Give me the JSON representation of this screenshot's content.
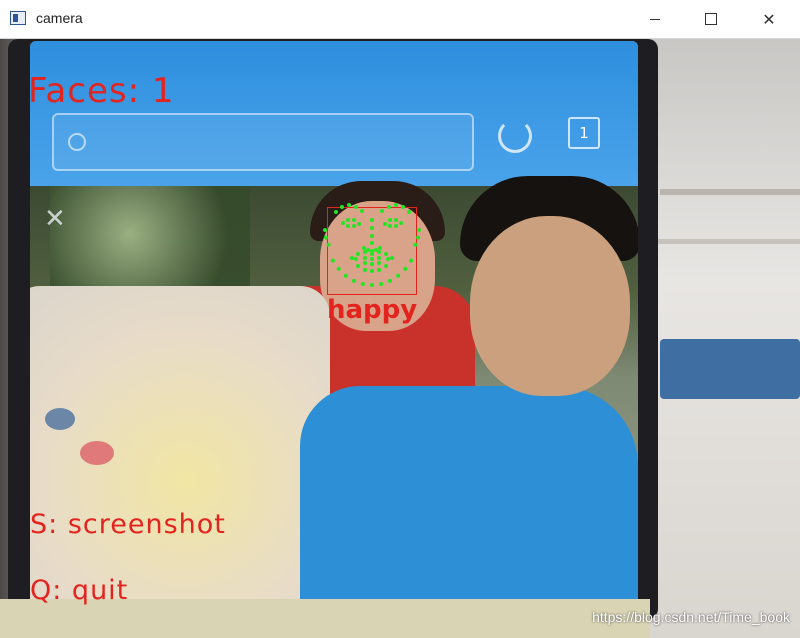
{
  "window": {
    "title": "camera",
    "icon": "app-window-icon",
    "controls": [
      "minimize-icon",
      "maximize-icon",
      "close-icon"
    ]
  },
  "overlay": {
    "faces_label": "Faces: 1",
    "screenshot_hint": "S: screenshot",
    "quit_hint": "Q: quit",
    "emotion_label": "happy",
    "overlay_color": "#e3241e",
    "landmark_color": "#22e622"
  },
  "phone_screen": {
    "status_text": "",
    "close_icon": "close-icon",
    "search_icon": "search-icon",
    "refresh_icon": "refresh-icon",
    "tabs_icon_count": "1"
  },
  "watermark": "https://blog.csdn.net/Time_book"
}
